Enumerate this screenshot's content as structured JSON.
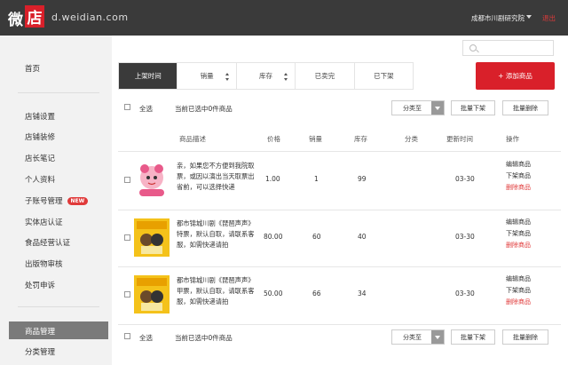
{
  "header": {
    "logo_left": "微",
    "logo_box": "店",
    "domain": "d.weidian.com",
    "shop_name": "成都市川剧研究院",
    "logout": "退出"
  },
  "sidebar": {
    "home": "首页",
    "items": [
      "店铺设置",
      "店铺装修",
      "店长笔记",
      "个人资料",
      "子账号管理",
      "实体店认证",
      "食品经营认证",
      "出版物审核",
      "处罚申诉"
    ],
    "new_badge": "NEW",
    "active": "商品管理",
    "category": "分类管理"
  },
  "main": {
    "search": {
      "placeholder": ""
    },
    "tabs": [
      {
        "label": "上架时间",
        "active": true
      },
      {
        "label": "销量",
        "sortable": true
      },
      {
        "label": "库存",
        "sortable": true
      },
      {
        "label": "已卖完"
      },
      {
        "label": "已下架"
      }
    ],
    "add_button": "+ 添加商品",
    "toolbar": {
      "select_all": "全选",
      "selected_count": "当前已选中0件商品",
      "category_select": "分类至",
      "unlist": "批量下架",
      "delete": "批量删除"
    },
    "table": {
      "headers": [
        "商品描述",
        "价格",
        "销量",
        "库存",
        "分类",
        "更新时间",
        "操作"
      ],
      "rows": [
        {
          "description": "亲，如果您不方便到我院取票，或因以演出当天取票出省前，可以选择快递",
          "price": "1.00",
          "sales": "1",
          "stock": "99",
          "category": "",
          "updated": "03-30",
          "ops": [
            "编辑商品",
            "下架商品",
            "删除商品"
          ],
          "thumb": "pink-cartoon"
        },
        {
          "description": "都市锦城川剧《琵琶声声》特票，默认自取，请联系客服，如需快递请拍",
          "price": "80.00",
          "sales": "60",
          "stock": "40",
          "category": "",
          "updated": "03-30",
          "ops": [
            "编辑商品",
            "下架商品",
            "删除商品"
          ],
          "thumb": "yellow-poster"
        },
        {
          "description": "都市锦城川剧《琵琶声声》甲票，默认自取，请联系客服，如需快递请拍",
          "price": "50.00",
          "sales": "66",
          "stock": "34",
          "category": "",
          "updated": "03-30",
          "ops": [
            "编辑商品",
            "下架商品",
            "删除商品"
          ],
          "thumb": "yellow-poster"
        }
      ]
    }
  },
  "colors": {
    "header_bg": "#3a3a3a",
    "accent": "#d9202a",
    "active_sidebar": "#7a7a7a"
  }
}
